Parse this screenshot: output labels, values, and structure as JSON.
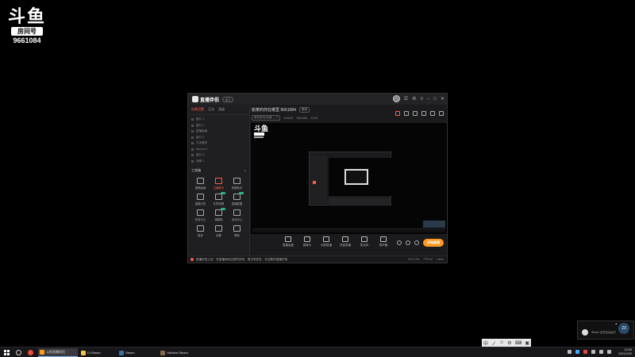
{
  "watermark": {
    "logo": "斗鱼",
    "tag": "房间号",
    "room": "9661084"
  },
  "app": {
    "logo": "直播伴侣",
    "version": "4.0",
    "tabs": [
      "场景设置",
      "互动",
      "高级"
    ],
    "scenes": [
      "窗口 1",
      "窗口 2",
      "直播画面",
      "窗口 3",
      "文本素材",
      "Source 2",
      "窗口 4",
      "场景 1"
    ],
    "tools_title": "工具箱",
    "tools": [
      {
        "label": "摄像画面",
        "red": false,
        "badge": false
      },
      {
        "label": "主播助手",
        "red": true,
        "badge": false
      },
      {
        "label": "房管助手",
        "red": false,
        "badge": false
      },
      {
        "label": "直播日历",
        "red": false,
        "badge": false
      },
      {
        "label": "礼物设置",
        "red": false,
        "badge": true
      },
      {
        "label": "直播数据",
        "red": false,
        "badge": true
      },
      {
        "label": "任务中心",
        "red": false,
        "badge": false
      },
      {
        "label": "弹幕姬",
        "red": false,
        "badge": true
      },
      {
        "label": "活动中心",
        "red": false,
        "badge": false
      },
      {
        "label": "更多",
        "red": false,
        "badge": false
      },
      {
        "label": "设置",
        "red": false,
        "badge": false
      },
      {
        "label": "帮助",
        "red": false,
        "badge": false
      }
    ],
    "room_title": "偷菜的你在哪里 9661084",
    "room_edit": "修改",
    "room_category": "单机游戏/战锤 二 Z",
    "room_meta": [
      "000000",
      "9661084",
      "23:50"
    ],
    "controls": [
      "直播画面",
      "摄像头",
      "全屏直播",
      "多窗直播",
      "麦克风",
      "扬声器"
    ],
    "start_button": "开始直播",
    "footer_notice": "直播伴侣公告：本直播间欢迎您的到来，请文明发言，共创美好直播环境",
    "footer_stats": [
      "CPU 12%",
      "FPS 60",
      "0 kb/s"
    ]
  },
  "notification": {
    "text": "Steam 正在后台运行",
    "percent": "23"
  },
  "ime": [
    "中",
    "ノ",
    "☺",
    "⚙",
    "⌨",
    "▣"
  ],
  "taskbar": {
    "items": [
      "斗鱼直播伴侣",
      "D:\\Steam",
      "Steam",
      "Valheim Steam"
    ],
    "time": "23:59",
    "date": "2021/2/20"
  },
  "colors": {
    "accent": "#ff5a4a",
    "start": "#ff9a1f"
  }
}
